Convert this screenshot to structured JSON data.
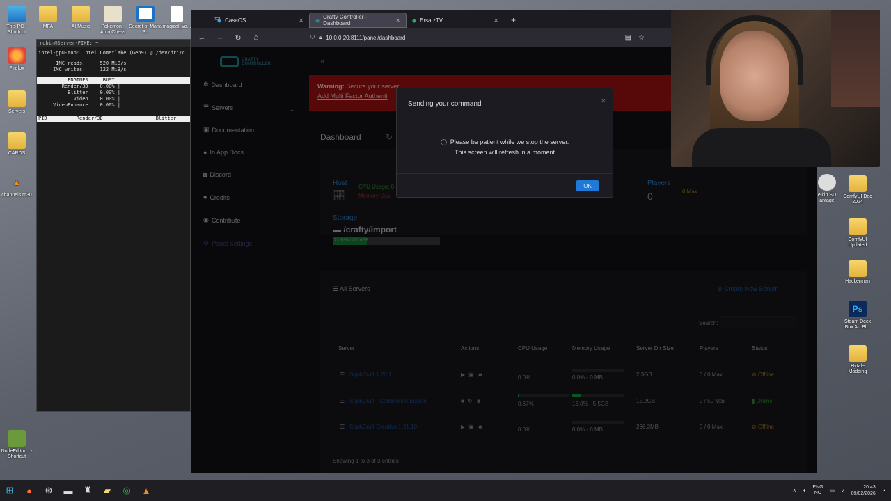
{
  "desktop": {
    "left_icons": [
      {
        "label": "This PC - Shortcut",
        "icon": "pc-icon"
      },
      {
        "label": "Firefox",
        "icon": "firefox-icon"
      },
      {
        "label": "Servers",
        "icon": "folder-icon"
      },
      {
        "label": "CARDS",
        "icon": "folder-icon"
      },
      {
        "label": "channels.m3u",
        "icon": "vlc-icon"
      },
      {
        "label": "NodeEditor... - Shortcut",
        "icon": "app-icon"
      }
    ],
    "top_icons": [
      {
        "label": "MFA",
        "icon": "folder-icon"
      },
      {
        "label": "AI Music",
        "icon": "folder-icon"
      },
      {
        "label": "Pokemon_ Auto Chess",
        "icon": "app-icon"
      },
      {
        "label": "Secret of Mana P...",
        "icon": "app-icon"
      },
      {
        "label": "magical_va...",
        "icon": "file-icon"
      }
    ],
    "right_icons": [
      {
        "label": "elkin SD antage",
        "icon": "app-icon"
      },
      {
        "label": "ComfyUI Dec 2024",
        "icon": "folder-icon"
      },
      {
        "label": "ComfyUI Updated",
        "icon": "folder-icon"
      },
      {
        "label": "Hackerman",
        "icon": "folder-icon"
      },
      {
        "label": "Steam Deck Box Art Bl...",
        "icon": "photoshop-icon"
      },
      {
        "label": "Hytale Modding",
        "icon": "folder-icon"
      }
    ]
  },
  "terminal": {
    "title": "robin@Server-PIKE: ~",
    "header": "intel-gpu-top: Intel Cometlake (Gen9) @ /dev/dri/c",
    "imc_reads": "      IMC reads:     520 MiB/s",
    "imc_writes": "     IMC writes:     122 MiB/s",
    "engines_header": "          ENGINES     BUSY",
    "engines": [
      "        Render/3D    0.00% |",
      "          Blitter    0.00% |",
      "            Video    0.00% |",
      "     VideoEnhance    0.00% |"
    ],
    "process_header": "PID          Render/3D                  Blitter"
  },
  "browser": {
    "tabs": [
      {
        "label": "CasaOS",
        "active": false
      },
      {
        "label": "Crafty Controller - Dashboard",
        "active": true
      },
      {
        "label": "ErsatzTV",
        "active": false
      }
    ],
    "new_tab": "+",
    "url": "10.0.0.20:8111/panel/dashboard"
  },
  "sidebar": {
    "logo_text": "CRAFTY CONTROLLER",
    "items": [
      {
        "label": "Dashboard",
        "icon": "dashboard-icon"
      },
      {
        "label": "Servers",
        "icon": "server-icon"
      },
      {
        "label": "Documentation",
        "icon": "book-icon"
      },
      {
        "label": "In App Docs",
        "icon": "info-icon"
      },
      {
        "label": "Discord",
        "icon": "discord-icon"
      },
      {
        "label": "Credits",
        "icon": "heart-icon"
      },
      {
        "label": "Contribute",
        "icon": "contribute-icon"
      },
      {
        "label": "Panel Settings",
        "icon": "settings-icon"
      }
    ],
    "collapse": "«",
    "arrow": "→"
  },
  "warning": {
    "bold": "Warning:",
    "text": "Secure your server",
    "link": "Add Multi Factor Authenti"
  },
  "dashboard": {
    "title": "Dashboard",
    "host_label": "Host",
    "cpu_usage": "CPU Usage: 0",
    "memory_usage": "Memory Usa",
    "players_label": "Players",
    "players_value": "0",
    "max_label": "0 Max",
    "storage_label": "Storage",
    "storage_path": "/crafty/import",
    "storage_text": "73.3GB / 229.6GB",
    "storage_fraction": 0.32
  },
  "servers": {
    "title": "All Servers",
    "create_label": "Create New Server",
    "search_label": "Search:",
    "columns": [
      "Server",
      "Actions",
      "CPU Usage",
      "Memory Usage",
      "Server Dir Size",
      "Players",
      "Status"
    ],
    "rows": [
      {
        "name": "SephCraft 1.20.1",
        "cpu": "0.0%",
        "memory": "0.0% - 0 MB",
        "mem_fraction": 0.0,
        "size": "2.3GB",
        "players": "0 / 0 Max",
        "status": "Offline"
      },
      {
        "name": "SephCraft - Cobblemon Edition",
        "cpu": "0.67%",
        "memory": "18.0% - 5.5GB",
        "mem_fraction": 0.18,
        "size": "15.2GB",
        "players": "0 / 50 Max",
        "status": "Online"
      },
      {
        "name": "SephCraft Creative 1.21.10",
        "cpu": "0.0%",
        "memory": "0.0% - 0 MB",
        "mem_fraction": 0.0,
        "size": "266.3MB",
        "players": "0 / 0 Max",
        "status": "Offline"
      }
    ],
    "entries": "Showing 1 to 3 of 3 entries"
  },
  "modal": {
    "title": "Sending your command",
    "line1": "Please be patient while we stop the server.",
    "line2": "This screen will refresh in a moment",
    "ok": "OK",
    "close": "×"
  },
  "taskbar": {
    "lang_top": "ENG",
    "lang_bottom": "NO",
    "time": "20:43",
    "date": "09/02/2026"
  }
}
